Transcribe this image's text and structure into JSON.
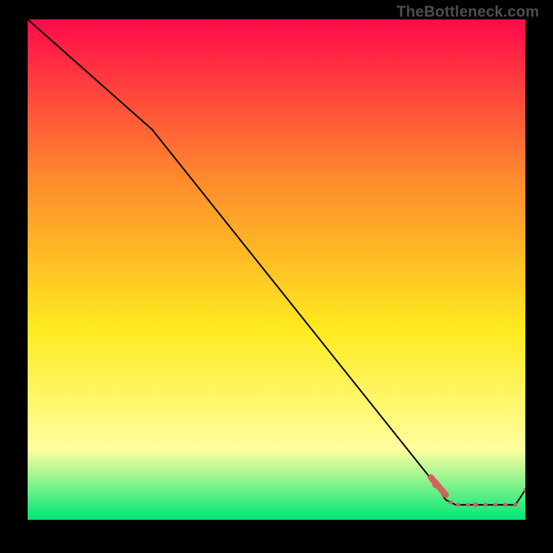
{
  "watermark": "TheBottleneck.com",
  "colors": {
    "gradient_top": "#ff0a4a",
    "gradient_mid1": "#ff8b2c",
    "gradient_mid2": "#ffea1f",
    "gradient_mid3": "#ffffa0",
    "gradient_bottom": "#00e676",
    "line": "#000000",
    "marker": "#d26060",
    "background": "#000000"
  },
  "chart_data": {
    "type": "line",
    "title": "",
    "xlabel": "",
    "ylabel": "",
    "xlim": [
      0,
      100
    ],
    "ylim": [
      0,
      100
    ],
    "series": [
      {
        "name": "bottleneck-curve",
        "x": [
          0,
          25,
          82,
          84,
          86,
          88,
          90,
          92,
          94,
          96,
          98,
          100
        ],
        "y": [
          100,
          78,
          7,
          4,
          3,
          3,
          3,
          3,
          3,
          3,
          3,
          6
        ]
      }
    ],
    "markers": {
      "name": "highlighted-points",
      "x": [
        82,
        85,
        86.5,
        88.5,
        90,
        92,
        94,
        96,
        98,
        100
      ],
      "y": [
        7,
        3.5,
        3,
        3,
        3,
        3,
        3,
        3,
        3,
        6
      ],
      "sizes": [
        5,
        3,
        3,
        3,
        3.5,
        3,
        3,
        3,
        3,
        3
      ]
    }
  }
}
